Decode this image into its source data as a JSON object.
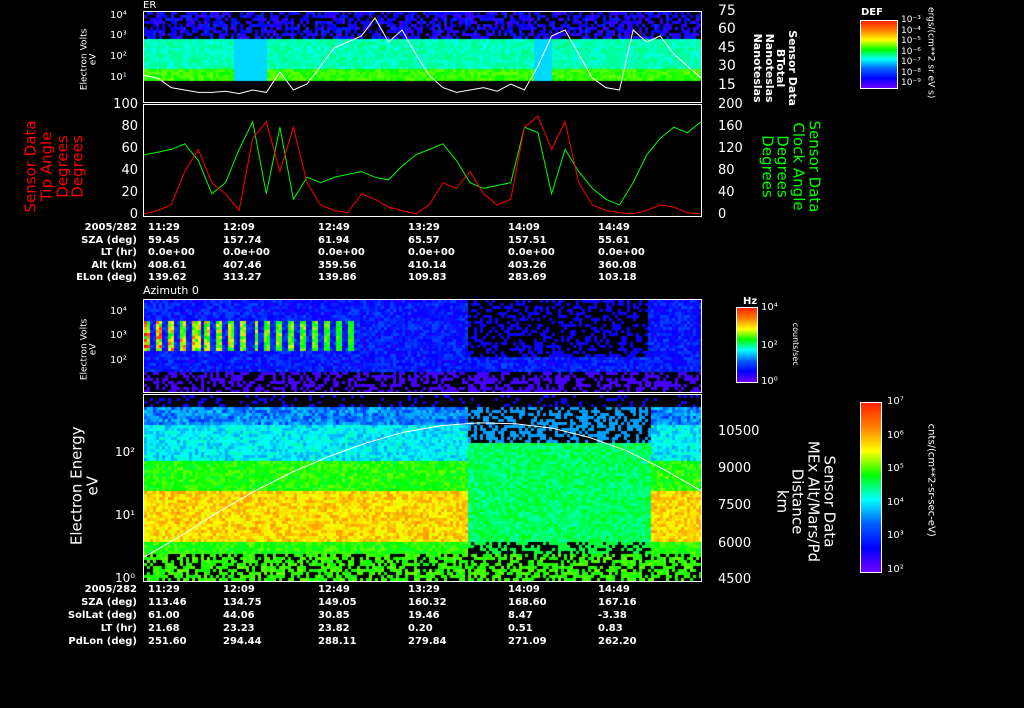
{
  "panel1": {
    "title": "ER",
    "ylabel": [
      "Electron Volts",
      "eV"
    ],
    "yticks": [
      "10⁴",
      "10³",
      "10²",
      "10¹"
    ],
    "right_ticks": [
      "75",
      "60",
      "45",
      "30",
      "15"
    ],
    "right_label": [
      "Sensor Data",
      "BTotal",
      "Nanoteslas",
      "Nanoteslas"
    ],
    "colorbar": {
      "title": "DEF",
      "ticks": [
        "10⁻³",
        "10⁻⁴",
        "10⁻⁵",
        "10⁻⁶",
        "10⁻⁷",
        "10⁻⁸",
        "10⁻⁹"
      ],
      "unit": "ergs/(cm**2 sr eV s)"
    }
  },
  "panel2": {
    "left_label": [
      "Sensor Data",
      "Tip Angle",
      "Degrees",
      "Degrees"
    ],
    "right_label": [
      "Sensor Data",
      "Clock Angle",
      "Degrees",
      "Degrees"
    ],
    "left_ticks": [
      "100",
      "80",
      "60",
      "40",
      "20",
      "0"
    ],
    "right_ticks": [
      "200",
      "160",
      "120",
      "80",
      "40",
      "0"
    ],
    "left_color": "#ff0000",
    "right_color": "#00ff00"
  },
  "ephem1": {
    "rows": [
      {
        "label": "2005/282",
        "values": [
          "11:29",
          "12:09",
          "12:49",
          "13:29",
          "14:09",
          "14:49"
        ]
      },
      {
        "label": "SZA (deg)",
        "values": [
          "59.45",
          "157.74",
          "61.94",
          "65.57",
          "157.51",
          "55.61"
        ]
      },
      {
        "label": "LT (hr)",
        "values": [
          "0.0e+00",
          "0.0e+00",
          "0.0e+00",
          "0.0e+00",
          "0.0e+00",
          "0.0e+00"
        ]
      },
      {
        "label": "Alt (km)",
        "values": [
          "408.61",
          "407.46",
          "359.56",
          "410.14",
          "403.26",
          "360.08"
        ]
      },
      {
        "label": "ELon (deg)",
        "values": [
          "139.62",
          "313.27",
          "139.86",
          "109.83",
          "283.69",
          "103.18"
        ]
      }
    ]
  },
  "panel3": {
    "title": "Azimuth 0",
    "ylabel": [
      "Electron Volts",
      "eV"
    ],
    "yticks": [
      "10⁴",
      "10³",
      "10²"
    ],
    "colorbar": {
      "title": "Hz",
      "ticks": [
        "10⁴",
        "10²",
        "10⁰"
      ],
      "unit": "counts/sec"
    }
  },
  "panel4": {
    "ylabel": [
      "Electron Energy",
      "eV"
    ],
    "yticks": [
      "10²",
      "10¹",
      "10⁰"
    ],
    "right_ticks": [
      "10500",
      "9000",
      "7500",
      "6000",
      "4500"
    ],
    "right_label": [
      "Sensor Data",
      "MEx Alt/Mars/Pd",
      "Distance",
      "km"
    ],
    "colorbar": {
      "ticks": [
        "10⁷",
        "10⁶",
        "10⁵",
        "10⁴",
        "10³",
        "10²"
      ],
      "unit": "cnts/(cm**2-sr-sec-eV)"
    }
  },
  "ephem2": {
    "rows": [
      {
        "label": "2005/282",
        "values": [
          "11:29",
          "12:09",
          "12:49",
          "13:29",
          "14:09",
          "14:49"
        ]
      },
      {
        "label": "SZA (deg)",
        "values": [
          "113.46",
          "134.75",
          "149.05",
          "160.32",
          "168.60",
          "167.16"
        ]
      },
      {
        "label": "SolLat (deg)",
        "values": [
          "61.00",
          "44.06",
          "30.85",
          "19.46",
          "8.47",
          "-3.38"
        ]
      },
      {
        "label": "LT (hr)",
        "values": [
          "21.68",
          "23.23",
          "23.82",
          "0.20",
          "0.51",
          "0.83"
        ]
      },
      {
        "label": "PdLon (deg)",
        "values": [
          "251.60",
          "294.44",
          "288.11",
          "279.84",
          "271.09",
          "262.20"
        ]
      }
    ]
  },
  "chart_data": [
    {
      "type": "heatmap",
      "title": "ER",
      "ylabel": "Electron Volts (eV)",
      "ylim": [
        5,
        20000
      ],
      "overlay": {
        "name": "BTotal (nT)",
        "ylim": [
          0,
          75
        ],
        "values": [
          22,
          20,
          12,
          10,
          8,
          8,
          9,
          7,
          10,
          8,
          25,
          10,
          15,
          30,
          45,
          50,
          55,
          70,
          50,
          60,
          40,
          22,
          12,
          8,
          10,
          12,
          9,
          15,
          10,
          30,
          55,
          60,
          40,
          20,
          12,
          10,
          60,
          50,
          55,
          40,
          30,
          20
        ]
      }
    },
    {
      "type": "line",
      "x": [
        "11:29",
        "12:09",
        "12:49",
        "13:29",
        "14:09",
        "14:49"
      ],
      "series": [
        {
          "name": "Tip Angle",
          "axis": "left",
          "ylim": [
            0,
            100
          ],
          "values": [
            2,
            5,
            10,
            40,
            60,
            30,
            20,
            5,
            70,
            85,
            40,
            80,
            30,
            10,
            5,
            3,
            20,
            15,
            8,
            5,
            2,
            10,
            30,
            25,
            40,
            20,
            10,
            15,
            80,
            90,
            60,
            85,
            30,
            10,
            5,
            3,
            2,
            5,
            10,
            8,
            3,
            2
          ]
        },
        {
          "name": "Clock Angle",
          "axis": "right",
          "ylim": [
            0,
            200
          ],
          "values": [
            110,
            115,
            120,
            130,
            100,
            40,
            60,
            120,
            170,
            40,
            160,
            30,
            70,
            60,
            70,
            75,
            80,
            70,
            65,
            90,
            110,
            120,
            130,
            100,
            60,
            50,
            55,
            60,
            160,
            150,
            40,
            120,
            80,
            50,
            30,
            20,
            60,
            110,
            140,
            160,
            150,
            170
          ]
        }
      ]
    },
    {
      "type": "heatmap",
      "title": "Azimuth 0",
      "ylabel": "Electron Volts (eV)",
      "ylim": [
        20,
        20000
      ]
    },
    {
      "type": "heatmap",
      "ylabel": "Electron Energy (eV)",
      "ylim": [
        1,
        1000
      ],
      "overlay": {
        "name": "MEx Alt/Mars/Pd Distance (km)",
        "ylim": [
          4500,
          11500
        ],
        "values": [
          5400,
          6200,
          7100,
          7900,
          8600,
          9200,
          9700,
          10100,
          10350,
          10450,
          10420,
          10250,
          9900,
          9400,
          8700,
          7900
        ]
      }
    }
  ]
}
